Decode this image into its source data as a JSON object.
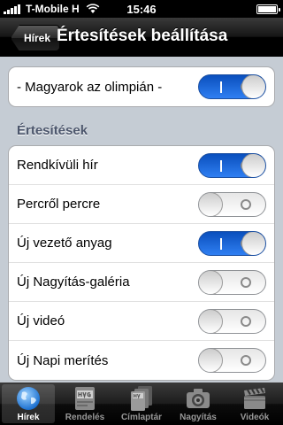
{
  "status_bar": {
    "carrier": "T-Mobile H",
    "time": "15:46"
  },
  "nav": {
    "back_label": "Hírek",
    "title": "Értesítések beállítása"
  },
  "top_group": {
    "label": "- Magyarok az olimpián -",
    "on": true
  },
  "section_header": "Értesítések",
  "notifications": [
    {
      "label": "Rendkívüli hír",
      "on": true
    },
    {
      "label": "Percről percre",
      "on": false
    },
    {
      "label": "Új vezető anyag",
      "on": true
    },
    {
      "label": "Új Nagyítás-galéria",
      "on": false
    },
    {
      "label": "Új videó",
      "on": false
    },
    {
      "label": "Új Napi merítés",
      "on": false
    }
  ],
  "tabs": [
    {
      "label": "Hírek",
      "icon": "globe-icon",
      "active": true
    },
    {
      "label": "Rendelés",
      "icon": "hvg-magazine-icon",
      "active": false
    },
    {
      "label": "Címlaptár",
      "icon": "hvg-covers-icon",
      "active": false
    },
    {
      "label": "Nagyítás",
      "icon": "camera-icon",
      "active": false
    },
    {
      "label": "Videók",
      "icon": "clapperboard-icon",
      "active": false
    }
  ],
  "colors": {
    "switch_on": "#2f7ff2",
    "section_header": "#4c566c",
    "background": "#c5ccd4"
  }
}
